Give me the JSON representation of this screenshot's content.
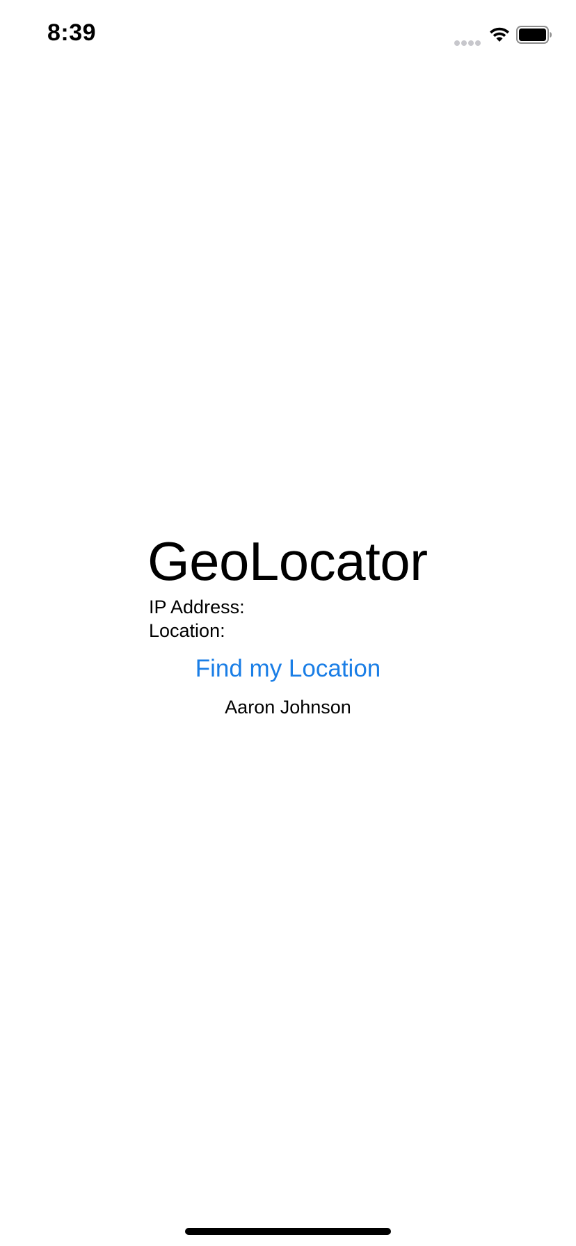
{
  "status_bar": {
    "time": "8:39",
    "signal_icon": "signal-dots-icon",
    "wifi_icon": "wifi-icon",
    "battery_icon": "battery-icon"
  },
  "main": {
    "title": "GeoLocator",
    "ip_label": "IP Address:",
    "location_label": "Location:",
    "find_button_label": "Find my Location",
    "author": "Aaron Johnson"
  },
  "colors": {
    "accent": "#1a7ee6",
    "text": "#000000",
    "background": "#ffffff"
  }
}
